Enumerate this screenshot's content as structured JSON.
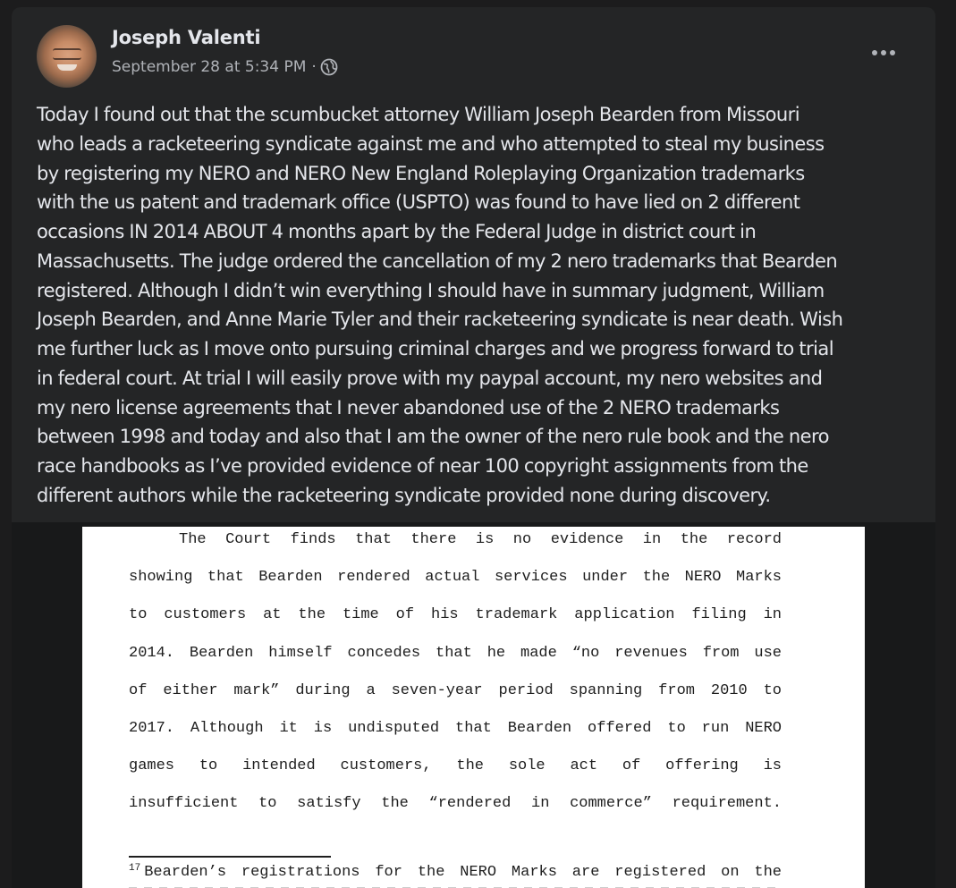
{
  "post": {
    "author_name": "Joseph Valenti",
    "timestamp": "September 28 at 5:34 PM",
    "separator": "·",
    "audience_icon": "globe-icon",
    "more_icon": "ellipsis-icon",
    "text_lines": [
      "Today I found out that the scumbucket attorney William Joseph Bearden from Missouri",
      "who leads a racketeering syndicate against me and who attempted to steal my business",
      "by registering my NERO and NERO New England Roleplaying Organization trademarks",
      "with the us patent and trademark office (USPTO) was found to have lied on 2 different",
      "occasions IN 2014 ABOUT 4 months apart by the Federal Judge in district court in",
      "Massachusetts. The judge ordered the cancellation of my 2 nero trademarks that Bearden",
      "registered. Although I didn’t win everything I should have in summary judgment, William",
      "Joseph Bearden, and Anne Marie Tyler and their racketeering syndicate is near death. Wish",
      "me further luck as I move onto pursuing criminal charges and we progress forward to trial",
      "in federal court. At trial I will easily prove with my paypal account, my nero websites and",
      "my nero license agreements that I never abandoned use of the 2 NERO trademarks",
      "between 1998 and today and also that I am the owner of the nero rule book and the nero",
      "race handbooks as I’ve provided evidence of near 100 copyright assignments from the",
      "different authors while the racketeering syndicate provided none during discovery."
    ]
  },
  "attachment": {
    "doc_lines": [
      "The Court finds that there is no evidence in the record",
      "showing that Bearden rendered actual services under the NERO Marks",
      "to customers at the time of his trademark application filing in",
      "2014. Bearden himself concedes that he made “no revenues from use",
      "of either mark” during a seven-year period spanning from 2010 to",
      "2017. Although it is undisputed that Bearden offered to run NERO",
      "games to intended customers, the sole act of offering is",
      "insufficient to satisfy the “rendered in commerce” requirement."
    ],
    "footnote_number": "17",
    "footnote_text": "Bearden’s registrations for the NERO Marks are registered on the"
  }
}
